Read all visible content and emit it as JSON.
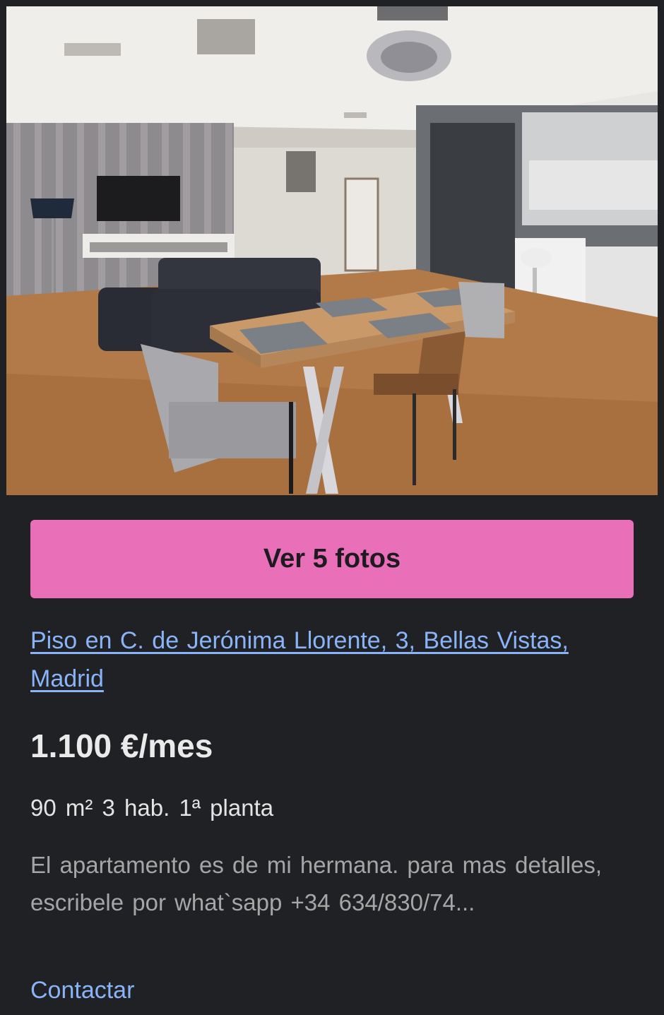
{
  "listing": {
    "photo_alt": "",
    "photos_button_label": "Ver 5 fotos",
    "title": "Piso en C. de Jerónima Llorente, 3, Bellas Vistas, Madrid",
    "price": "1.100 €/mes",
    "features": "90 m² 3 hab. 1ª planta",
    "description": "El apartamento es de mi hermana. para mas detalles, escribele por what`sapp +34 634/830/74...",
    "contact_label": "Contactar"
  },
  "colors": {
    "background": "#202124",
    "button": "#e96fb8",
    "link": "#8ab4f8",
    "price_text": "#eaeaea",
    "description_text": "#a6a6a6"
  }
}
